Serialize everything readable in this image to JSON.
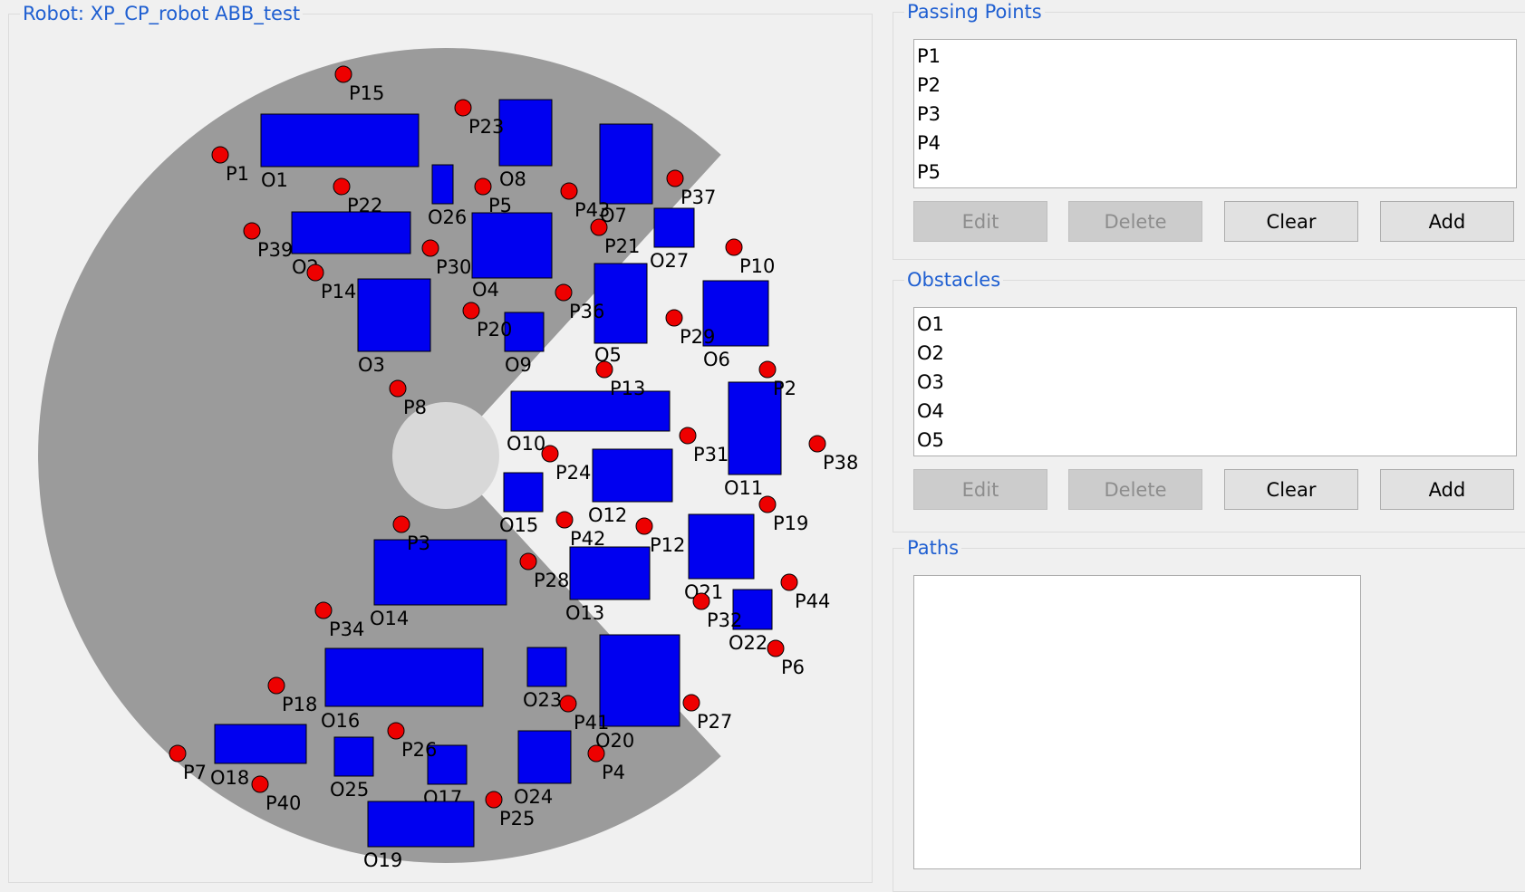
{
  "robot_panel": {
    "title": "Robot: XP_CP_robot ABB_test",
    "colors": {
      "workspace": "#9b9b9b",
      "inner_hub": "#d8d8d8",
      "obstacle": "#0000f0",
      "point": "#ee0000"
    },
    "obstacles": [
      "O1",
      "O2",
      "O3",
      "O4",
      "O5",
      "O6",
      "O7",
      "O8",
      "O9",
      "O10",
      "O11",
      "O12",
      "O13",
      "O14",
      "O15",
      "O16",
      "O17",
      "O18",
      "O19",
      "O20",
      "O21",
      "O22",
      "O23",
      "O24",
      "O25",
      "O26",
      "O27"
    ],
    "points": [
      "P1",
      "P2",
      "P3",
      "P4",
      "P5",
      "P6",
      "P7",
      "P8",
      "P10",
      "P12",
      "P13",
      "P14",
      "P15",
      "P18",
      "P19",
      "P20",
      "P21",
      "P22",
      "P23",
      "P24",
      "P25",
      "P26",
      "P27",
      "P28",
      "P29",
      "P30",
      "P31",
      "P32",
      "P34",
      "P36",
      "P37",
      "P38",
      "P39",
      "P40",
      "P41",
      "P42",
      "P43",
      "P44"
    ]
  },
  "passing_points": {
    "title": "Passing Points",
    "items": [
      "P1",
      "P2",
      "P3",
      "P4",
      "P5"
    ],
    "buttons": {
      "edit": "Edit",
      "delete": "Delete",
      "clear": "Clear",
      "add": "Add"
    }
  },
  "obstacles_panel": {
    "title": "Obstacles",
    "items": [
      "O1",
      "O2",
      "O3",
      "O4",
      "O5"
    ],
    "buttons": {
      "edit": "Edit",
      "delete": "Delete",
      "clear": "Clear",
      "add": "Add"
    }
  },
  "paths_panel": {
    "title": "Paths",
    "items": []
  }
}
